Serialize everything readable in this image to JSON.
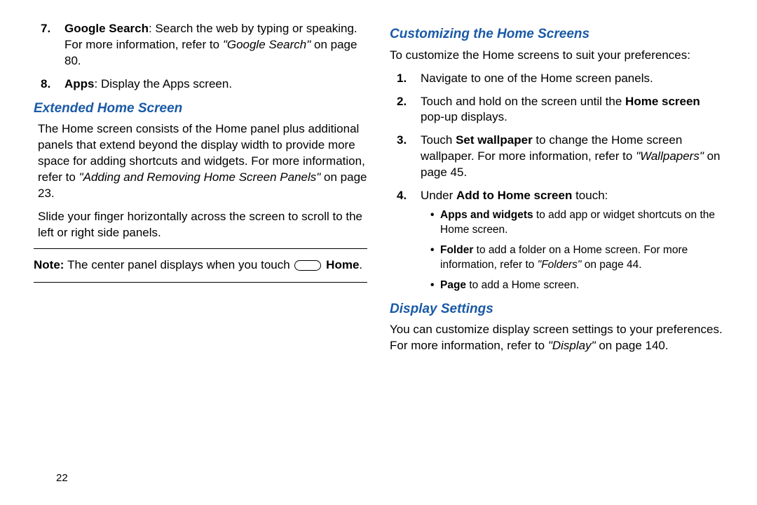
{
  "leftCol": {
    "list7": {
      "item7_lead": "Google Search",
      "item7_text1": ": Search the web by typing or speaking. For more information, refer to ",
      "item7_ref": "\"Google Search\"",
      "item7_text2": " on page 80.",
      "item8_lead": "Apps",
      "item8_text": ": Display the Apps screen."
    },
    "heading1": "Extended Home Screen",
    "para1a": "The Home screen consists of the Home panel plus additional panels that extend beyond the display width to provide more space for adding shortcuts and widgets. For more information, refer to ",
    "para1_ref": "\"Adding and Removing Home Screen Panels\"",
    "para1b": " on page 23.",
    "para2": "Slide your finger horizontally across the screen to scroll to the left or right side panels.",
    "note_lead": "Note: ",
    "note_text1": "The center panel displays when you touch ",
    "note_home": " Home",
    "note_text2": "."
  },
  "rightCol": {
    "heading1": "Customizing the Home Screens",
    "intro": "To customize the Home screens to suit your preferences:",
    "step1": "Navigate to one of the Home screen panels.",
    "step2a": "Touch and hold on the screen until the ",
    "step2_bold": "Home screen",
    "step2b": " pop-up displays.",
    "step3a": "Touch ",
    "step3_bold": "Set wallpaper",
    "step3b": " to change the Home screen wallpaper. For more information, refer to ",
    "step3_ref": "\"Wallpapers\"",
    "step3c": " on page 45.",
    "step4a": "Under ",
    "step4_bold": "Add to Home screen",
    "step4b": " touch:",
    "b1_bold": "Apps and widgets",
    "b1_text": " to add app or widget shortcuts on the Home screen.",
    "b2_bold": "Folder",
    "b2_text1": " to add a folder on a Home screen. For more information, refer to ",
    "b2_ref": "\"Folders\"",
    "b2_text2": " on page 44.",
    "b3_bold": "Page",
    "b3_text": " to add a Home screen.",
    "heading2": "Display Settings",
    "para2a": "You can customize display screen settings to your preferences. For more information, refer to ",
    "para2_ref": "\"Display\"",
    "para2b": " on page 140."
  },
  "pageNumber": "22"
}
